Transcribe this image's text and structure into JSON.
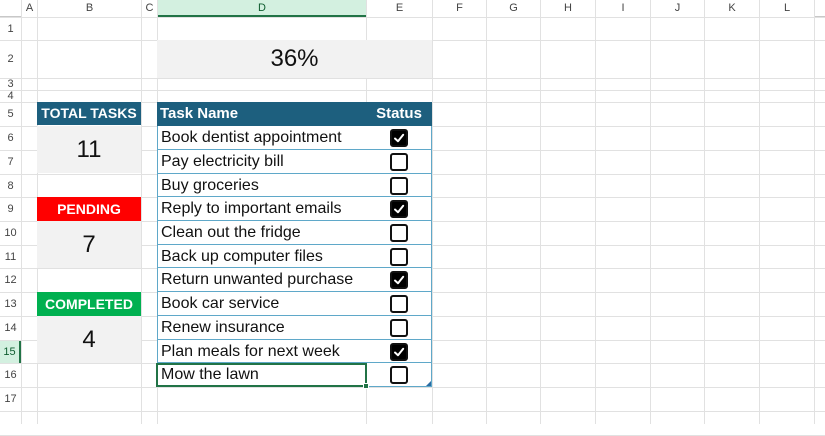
{
  "columns": [
    "A",
    "B",
    "C",
    "D",
    "E",
    "F",
    "G",
    "H",
    "I",
    "J",
    "K",
    "L"
  ],
  "rows": [
    "1",
    "2",
    "3",
    "4",
    "5",
    "6",
    "7",
    "8",
    "9",
    "10",
    "11",
    "12",
    "13",
    "14",
    "15",
    "16",
    "17"
  ],
  "progress": {
    "label": "36%",
    "value": 0.36
  },
  "stats": {
    "total": {
      "label": "TOTAL TASKS",
      "value": "11"
    },
    "pending": {
      "label": "PENDING",
      "value": "7"
    },
    "completed": {
      "label": "COMPLETED",
      "value": "4"
    }
  },
  "table": {
    "headers": {
      "name": "Task Name",
      "status": "Status"
    },
    "tasks": [
      {
        "name": "Book dentist appointment",
        "done": true
      },
      {
        "name": "Pay electricity bill",
        "done": false
      },
      {
        "name": "Buy groceries",
        "done": false
      },
      {
        "name": "Reply to important emails",
        "done": true
      },
      {
        "name": "Clean out the fridge",
        "done": false
      },
      {
        "name": "Back up computer files",
        "done": false
      },
      {
        "name": "Return unwanted purchase",
        "done": true
      },
      {
        "name": "Book car service",
        "done": false
      },
      {
        "name": "Renew insurance",
        "done": false
      },
      {
        "name": "Plan meals for next week",
        "done": true
      },
      {
        "name": "Mow the lawn",
        "done": false
      }
    ]
  },
  "colors": {
    "header_blue": "#1d5f7e",
    "pending_red": "#ff0000",
    "completed_green": "#00b050",
    "stat_bg": "#f2f2f2",
    "selection_green": "#217346",
    "table_border": "#5fa8c9"
  }
}
